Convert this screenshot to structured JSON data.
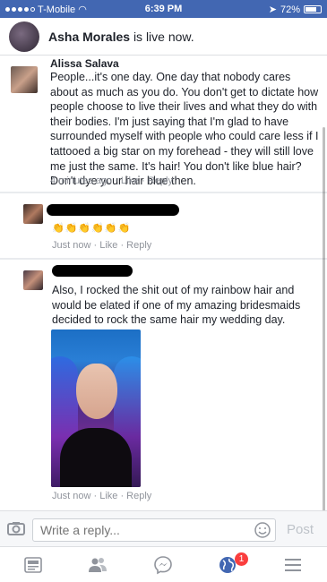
{
  "status_bar": {
    "carrier": "T-Mobile",
    "time": "6:39 PM",
    "battery": "72%"
  },
  "banner": {
    "name": "Asha Morales",
    "text": "is live now."
  },
  "comments": [
    {
      "name": "Alissa Salava",
      "text": "People...it's one day. One day that nobody cares about as much as you do. You don't get to dictate how people choose to live their lives and what they do with their bodies. I'm just saying that I'm glad to have surrounded myself with people who could care less if I tattooed a big star on my forehead - they will still love me just the same. It's hair! You don't like blue hair? Don't dye your hair blue then.",
      "time": "4 minutes ago",
      "like": "Like",
      "reply": "Reply"
    },
    {
      "name": "",
      "emoji": "👏👏👏👏👏👏",
      "time": "Just now",
      "like": "Like",
      "reply": "Reply"
    },
    {
      "name": "",
      "text": "Also, I rocked the shit out of my rainbow hair and would be elated if one of my amazing bridesmaids decided to rock the same hair my wedding day.",
      "time": "Just now",
      "like": "Like",
      "reply": "Reply"
    }
  ],
  "reply_bar": {
    "placeholder": "Write a reply...",
    "post": "Post"
  },
  "tab_bar": {
    "notifications_badge": "1"
  },
  "colors": {
    "accent": "#4267b2",
    "badge": "#fa3e3e",
    "meta": "#90949c"
  }
}
